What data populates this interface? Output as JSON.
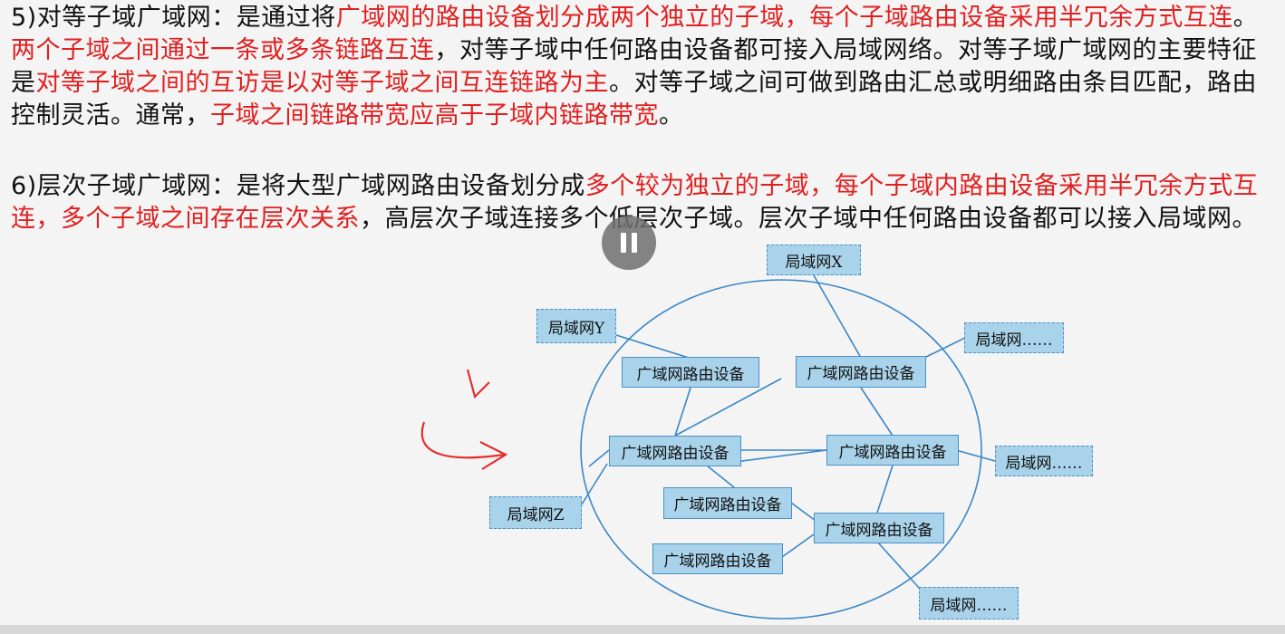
{
  "para5": {
    "prefix": "5)",
    "segments": [
      {
        "t": "对等子域广域网：是通过将",
        "red": false
      },
      {
        "t": "广域网的路由设备划分成两个独立的子域，每个子域路由设备采用半冗余方式互连",
        "red": true
      },
      {
        "t": "。",
        "red": false
      },
      {
        "t": "两个子域之间通过一条或多条链路互连",
        "red": true
      },
      {
        "t": "，对等子域中任何路由设备都可接入局域网络。对等子域广域网的主要特征是",
        "red": false
      },
      {
        "t": "对等子域之间的互访是以对等子域之间互连链路为主",
        "red": true
      },
      {
        "t": "。对等子域之间可做到路由汇总或明细路由条目匹配，路由控制灵活。通常，",
        "red": false
      },
      {
        "t": "子域之间链路带宽应高于子域内链路带宽",
        "red": true
      },
      {
        "t": "。",
        "red": false
      }
    ]
  },
  "para6": {
    "prefix": "6)",
    "segments": [
      {
        "t": "层次子域广域网：是将大型广域网路由设备划分成",
        "red": false
      },
      {
        "t": "多个较为独立的子域，每个子域内路由设备采用半冗余方式互连，多个子域之间存在层次关系",
        "red": true
      },
      {
        "t": "，高层次子域连接多个低层次子域。层次子域中任何路由设备都可以接入局域网。",
        "red": false
      }
    ]
  },
  "diagram": {
    "lan_x": "局域网X",
    "lan_y": "局域网Y",
    "lan_z": "局域网Z",
    "lan_more_1": "局域网……",
    "lan_more_2": "局域网……",
    "lan_more_3": "局域网……",
    "router_label": "广域网路由设备"
  },
  "colors": {
    "highlight": "#e02020",
    "node_fill": "#a9d3ea",
    "line": "#3a86c8"
  },
  "icons": {
    "pause": "pause-icon",
    "annotation": "hand-drawn-arrow"
  }
}
